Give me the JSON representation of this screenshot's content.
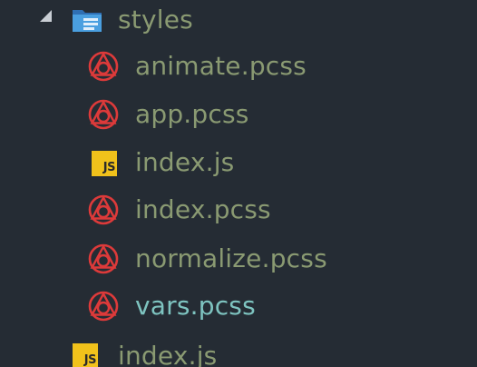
{
  "explorer": {
    "folder": {
      "label": "styles",
      "icon": "folder-icon",
      "expanded": true
    },
    "files": [
      {
        "label": "animate.pcss",
        "icon": "postcss-icon"
      },
      {
        "label": "app.pcss",
        "icon": "postcss-icon"
      },
      {
        "label": "index.js",
        "icon": "js-icon",
        "badge": "JS"
      },
      {
        "label": "index.pcss",
        "icon": "postcss-icon"
      },
      {
        "label": "normalize.pcss",
        "icon": "postcss-icon"
      },
      {
        "label": "vars.pcss",
        "icon": "postcss-icon",
        "selected": true
      }
    ],
    "sibling": {
      "label": "index.js",
      "icon": "js-icon",
      "badge": "JS"
    }
  },
  "colors": {
    "background": "#252c34",
    "label": "#8a9a72",
    "selected_label": "#7ec4c0",
    "postcss_red": "#dd3a3a",
    "js_yellow": "#f1c21b",
    "folder_blue": "#4a9fe0"
  }
}
